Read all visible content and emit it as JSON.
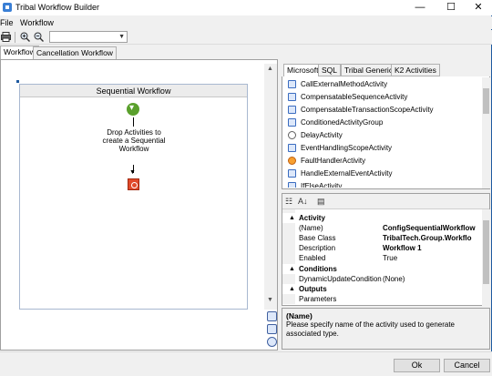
{
  "window": {
    "title": "Tribal Workflow Builder",
    "controls": {
      "minimize": "—",
      "maximize": "☐",
      "close": "✕"
    }
  },
  "menu": {
    "items": [
      "File",
      "Workflow"
    ]
  },
  "toolbar": {
    "icons": [
      "print-icon",
      "zoom-in-icon",
      "zoom-out-icon"
    ],
    "zoom_value": ""
  },
  "doc_tabs": [
    "Workflow",
    "Cancellation Workflow"
  ],
  "designer": {
    "sequence_title": "Sequential Workflow",
    "drop_hint": "Drop Activities to create a Sequential Workflow"
  },
  "toolbox": {
    "tabs": [
      "Microsoft",
      "SQL",
      "Tribal Generic",
      "K2 Activities"
    ],
    "items": [
      "CallExternalMethodActivity",
      "CompensatableSequenceActivity",
      "CompensatableTransactionScopeActivity",
      "ConditionedActivityGroup",
      "DelayActivity",
      "EventHandlingScopeActivity",
      "FaultHandlerActivity",
      "HandleExternalEventActivity",
      "IfElseActivity"
    ]
  },
  "properties": {
    "categories": {
      "activity": "Activity",
      "conditions": "Conditions",
      "outputs": "Outputs"
    },
    "rows": {
      "name": {
        "label": "(Name)",
        "value": "ConfigSequentialWorkflow"
      },
      "base_class": {
        "label": "Base Class",
        "value": "TribalTech.Group.Workflo"
      },
      "description": {
        "label": "Description",
        "value": "Workflow 1"
      },
      "enabled": {
        "label": "Enabled",
        "value": "True"
      },
      "dynamic_update": {
        "label": "DynamicUpdateCondition",
        "value": "(None)"
      },
      "parameters": {
        "label": "Parameters",
        "value": ""
      }
    }
  },
  "description_panel": {
    "title": "(Name)",
    "text": "Please specify name of the activity used to generate associated type."
  },
  "buttons": {
    "ok": "Ok",
    "cancel": "Cancel"
  }
}
